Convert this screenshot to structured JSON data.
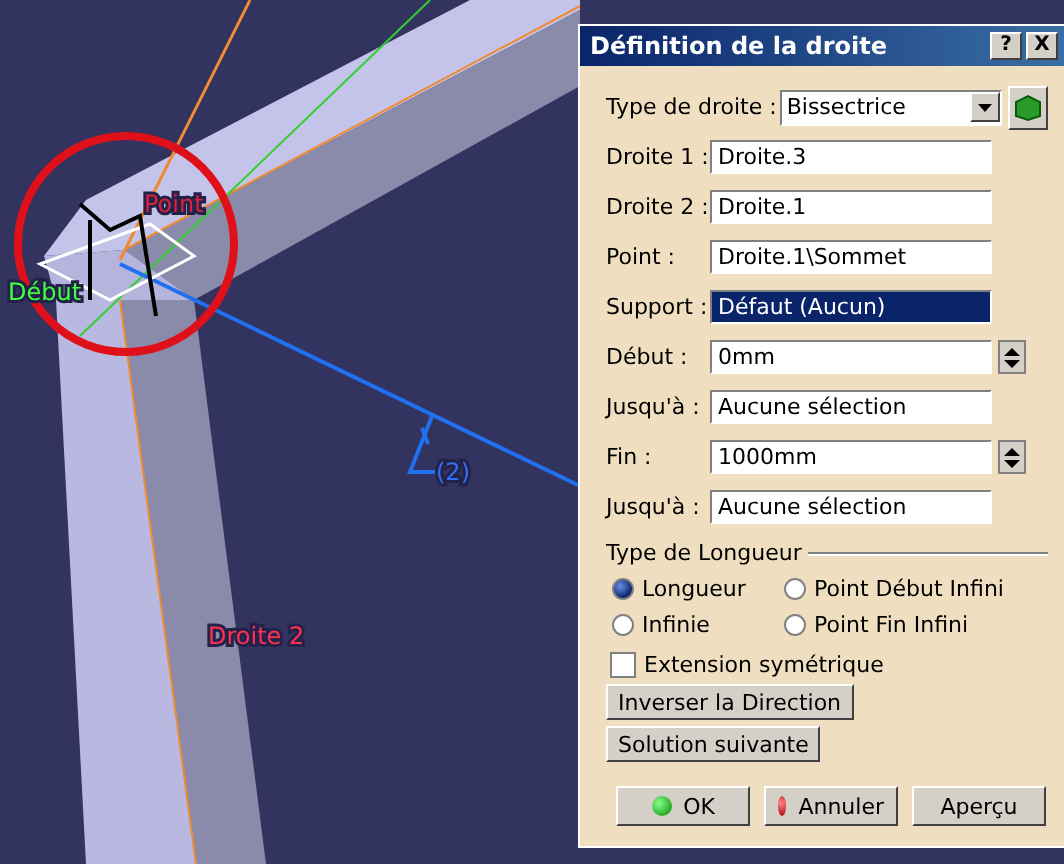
{
  "viewport": {
    "labels": [
      {
        "text": "Point",
        "kind": "point"
      },
      {
        "text": "Début",
        "kind": "start"
      },
      {
        "text": "(2)",
        "kind": "constraint"
      },
      {
        "text": "Droite 2",
        "kind": "line"
      }
    ]
  },
  "dialog": {
    "title": "Définition de la droite",
    "title_buttons": [
      "?",
      "X"
    ],
    "type_row": {
      "label": "Type de droite :",
      "value": "Bissectrice"
    },
    "fields": [
      {
        "label": "Droite 1 :",
        "value": "Droite.3",
        "kind": "text",
        "selected": false
      },
      {
        "label": "Droite 2 :",
        "value": "Droite.1",
        "kind": "text",
        "selected": false
      },
      {
        "label": "Point :",
        "value": "Droite.1\\Sommet",
        "kind": "text",
        "selected": false
      },
      {
        "label": "Support :",
        "value": "Défaut (Aucun)",
        "kind": "text",
        "selected": true
      },
      {
        "label": "Début :",
        "value": "0mm",
        "kind": "spin",
        "selected": false
      },
      {
        "label": "Jusqu'à :",
        "value": "Aucune sélection",
        "kind": "text",
        "selected": false
      },
      {
        "label": "Fin :",
        "value": "1000mm",
        "kind": "spin",
        "selected": false
      },
      {
        "label": "Jusqu'à :",
        "value": "Aucune sélection",
        "kind": "text",
        "selected": false
      }
    ],
    "group": {
      "title": "Type de Longueur",
      "radios": [
        {
          "label": "Longueur",
          "selected": true
        },
        {
          "label": "Point Début Infini",
          "selected": false
        },
        {
          "label": "Infinie",
          "selected": false
        },
        {
          "label": "Point Fin Infini",
          "selected": false
        }
      ]
    },
    "checkbox": {
      "label": "Extension symétrique",
      "checked": false
    },
    "buttons": [
      "Inverser la Direction",
      "Solution suivante"
    ],
    "footer": [
      {
        "label": "OK",
        "kind": "ok"
      },
      {
        "label": "Annuler",
        "kind": "cancel"
      },
      {
        "label": "Aperçu",
        "kind": "plain"
      }
    ]
  }
}
